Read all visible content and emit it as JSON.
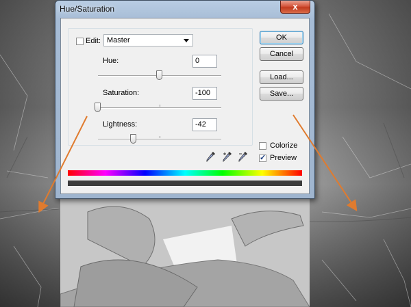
{
  "window": {
    "title": "Hue/Saturation",
    "close_label": "x"
  },
  "edit": {
    "label": "Edit:",
    "selected": "Master"
  },
  "hue": {
    "label": "Hue:",
    "value": "0",
    "level": 0.5
  },
  "saturation": {
    "label": "Saturation:",
    "value": "-100",
    "level": 0.0
  },
  "lightness": {
    "label": "Lightness:",
    "value": "-42",
    "level": 0.29
  },
  "buttons": {
    "ok": "OK",
    "cancel": "Cancel",
    "load": "Load...",
    "save": "Save..."
  },
  "checkboxes": {
    "colorize": {
      "label": "Colorize",
      "checked": false
    },
    "preview": {
      "label": "Preview",
      "checked": true
    }
  },
  "icons": [
    "eyedropper-icon",
    "eyedropper-plus-icon",
    "eyedropper-minus-icon"
  ],
  "colors": {
    "annotation_arrow": "#e07b2e",
    "title_bar": "#a6bcd6",
    "ok_border": "#3c7fb1"
  }
}
